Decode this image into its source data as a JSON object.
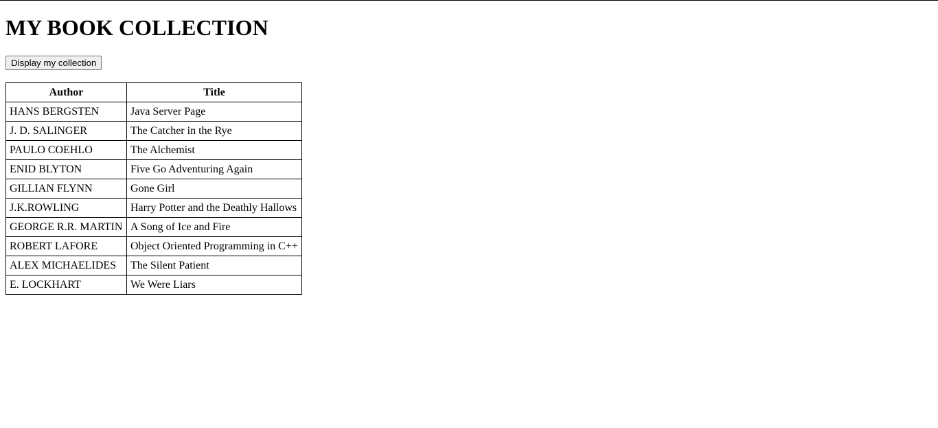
{
  "page": {
    "heading": "MY BOOK COLLECTION",
    "button_label": "Display my collection"
  },
  "table": {
    "headers": [
      "Author",
      "Title"
    ],
    "rows": [
      [
        "HANS BERGSTEN",
        "Java Server Page"
      ],
      [
        "J. D. SALINGER",
        "The Catcher in the Rye"
      ],
      [
        "PAULO COEHLO",
        "The Alchemist"
      ],
      [
        "ENID BLYTON",
        "Five Go Adventuring Again"
      ],
      [
        "GILLIAN FLYNN",
        "Gone Girl"
      ],
      [
        "J.K.ROWLING",
        "Harry Potter and the Deathly Hallows"
      ],
      [
        "GEORGE R.R. MARTIN",
        "A Song of Ice and Fire"
      ],
      [
        "ROBERT LAFORE",
        "Object Oriented Programming in C++"
      ],
      [
        "ALEX MICHAELIDES",
        "The Silent Patient"
      ],
      [
        "E. LOCKHART",
        "We Were Liars"
      ]
    ]
  }
}
